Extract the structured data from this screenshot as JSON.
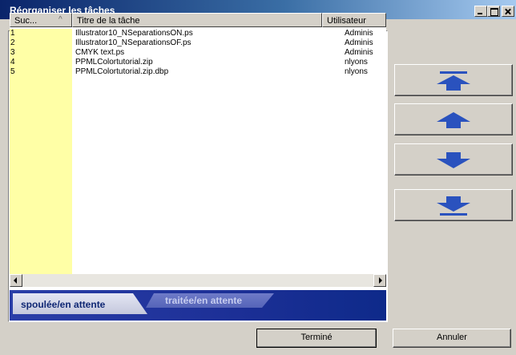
{
  "window": {
    "title": "Réorganiser les tâches"
  },
  "table": {
    "columns": [
      "Suc...",
      "Titre de la tâche",
      "Utilisateur"
    ],
    "sort_indicator": "^",
    "rows": [
      {
        "seq": "1",
        "title": "Illustrator10_NSeparationsON.ps",
        "user": "Adminis"
      },
      {
        "seq": "2",
        "title": "Illustrator10_NSeparationsOF.ps",
        "user": "Adminis"
      },
      {
        "seq": "3",
        "title": "CMYK text.ps",
        "user": "Adminis"
      },
      {
        "seq": "4",
        "title": "PPMLColortutorial.zip",
        "user": "nlyons"
      },
      {
        "seq": "5",
        "title": "PPMLColortutorial.zip.dbp",
        "user": "nlyons"
      }
    ]
  },
  "tabs": {
    "active": "spoulée/en attente",
    "inactive": "traitée/en attente"
  },
  "side_buttons": [
    {
      "name": "move-to-top",
      "icon": "arrow-up-bar-icon"
    },
    {
      "name": "move-up",
      "icon": "arrow-up-icon"
    },
    {
      "name": "move-down",
      "icon": "arrow-down-icon"
    },
    {
      "name": "move-to-bottom",
      "icon": "arrow-down-bar-icon"
    }
  ],
  "buttons": {
    "done": "Terminé",
    "cancel": "Annuler"
  },
  "colors": {
    "accent": "#2a52be",
    "highlight_column": "#ffffa6",
    "tabbar": "#1c2f96"
  }
}
